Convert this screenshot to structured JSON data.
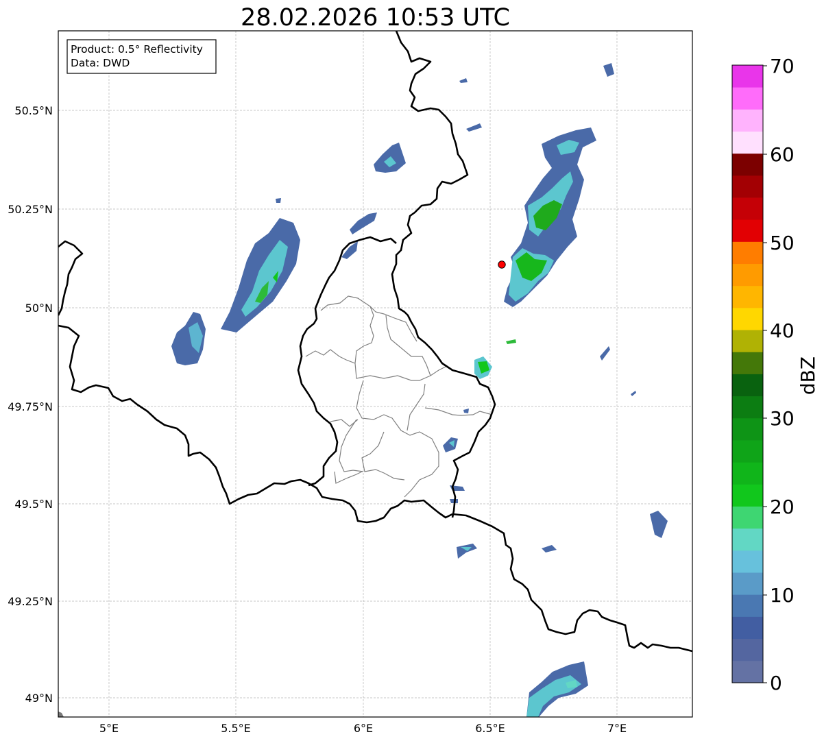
{
  "title": "28.02.2026 10:53 UTC",
  "info_box": {
    "line1": "Product: 0.5° Reflectivity",
    "line2": "Data: DWD"
  },
  "axes": {
    "lon_ticks": [
      "5°E",
      "5.5°E",
      "6°E",
      "6.5°E",
      "7°E"
    ],
    "lat_ticks": [
      "50.5°N",
      "50.25°N",
      "50°N",
      "49.75°N",
      "49.5°N",
      "49.25°N",
      "49°N"
    ],
    "grid": true
  },
  "colorbar": {
    "label": "dBZ",
    "ticks": [
      "70",
      "60",
      "50",
      "40",
      "30",
      "20",
      "10",
      "0"
    ],
    "colors": [
      "#6472a4",
      "#5466a0",
      "#425ea2",
      "#4a78b2",
      "#5a9bc8",
      "#67c1dc",
      "#62d7c4",
      "#3ed672",
      "#11c71c",
      "#10b51a",
      "#0fa418",
      "#0e9416",
      "#0c7d12",
      "#09620f",
      "#447809",
      "#b0b204",
      "#ffd700",
      "#ffb600",
      "#ff9b00",
      "#ff7d00",
      "#e20003",
      "#c50006",
      "#a30003",
      "#7c0000",
      "#ffe0fe",
      "#ffb3fd",
      "#ff6cfa",
      "#e935ea"
    ]
  },
  "radar_marker": {
    "color": "#ff0000"
  }
}
